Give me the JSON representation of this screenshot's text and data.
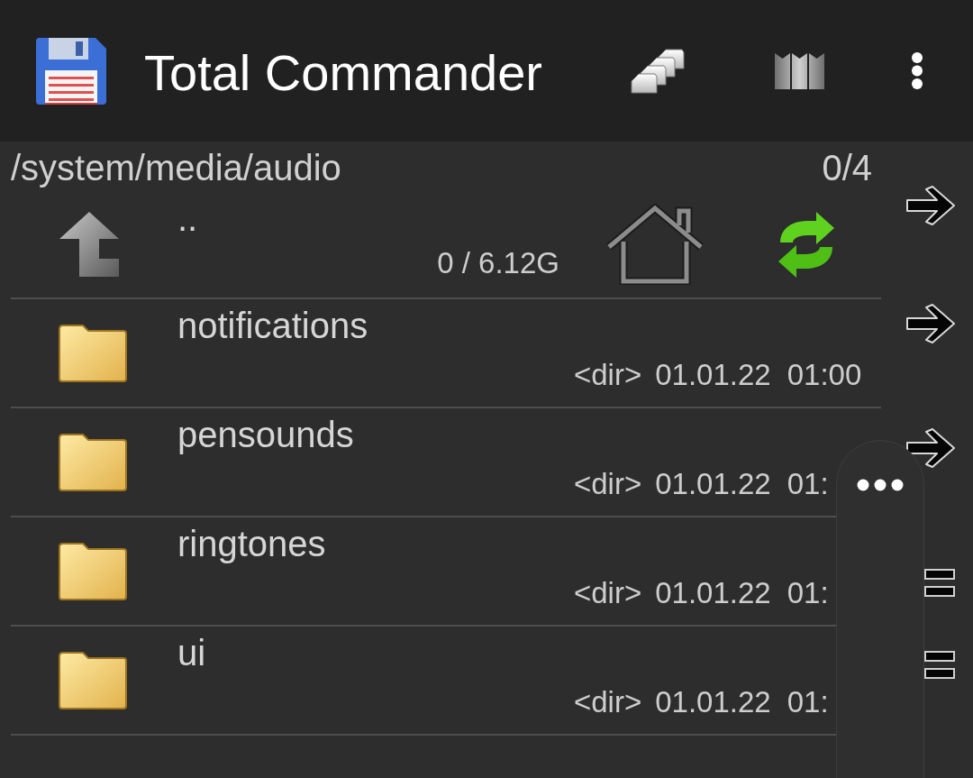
{
  "app_bar": {
    "title": "Total Commander"
  },
  "path_bar": {
    "path": "/system/media/audio",
    "count": "0/4"
  },
  "parent_row": {
    "name": "..",
    "space": "0 / 6.12G"
  },
  "files": [
    {
      "name": "notifications",
      "type": "<dir>",
      "date": "01.01.22",
      "time": "01:00"
    },
    {
      "name": "pensounds",
      "type": "<dir>",
      "date": "01.01.22",
      "time": "01:"
    },
    {
      "name": "ringtones",
      "type": "<dir>",
      "date": "01.01.22",
      "time": "01:"
    },
    {
      "name": "ui",
      "type": "<dir>",
      "date": "01.01.22",
      "time": "01:"
    }
  ],
  "side_buttons": [
    {
      "kind": "arrow"
    },
    {
      "kind": "arrow"
    },
    {
      "kind": "arrow"
    },
    {
      "kind": "lines"
    },
    {
      "kind": "lines"
    }
  ]
}
